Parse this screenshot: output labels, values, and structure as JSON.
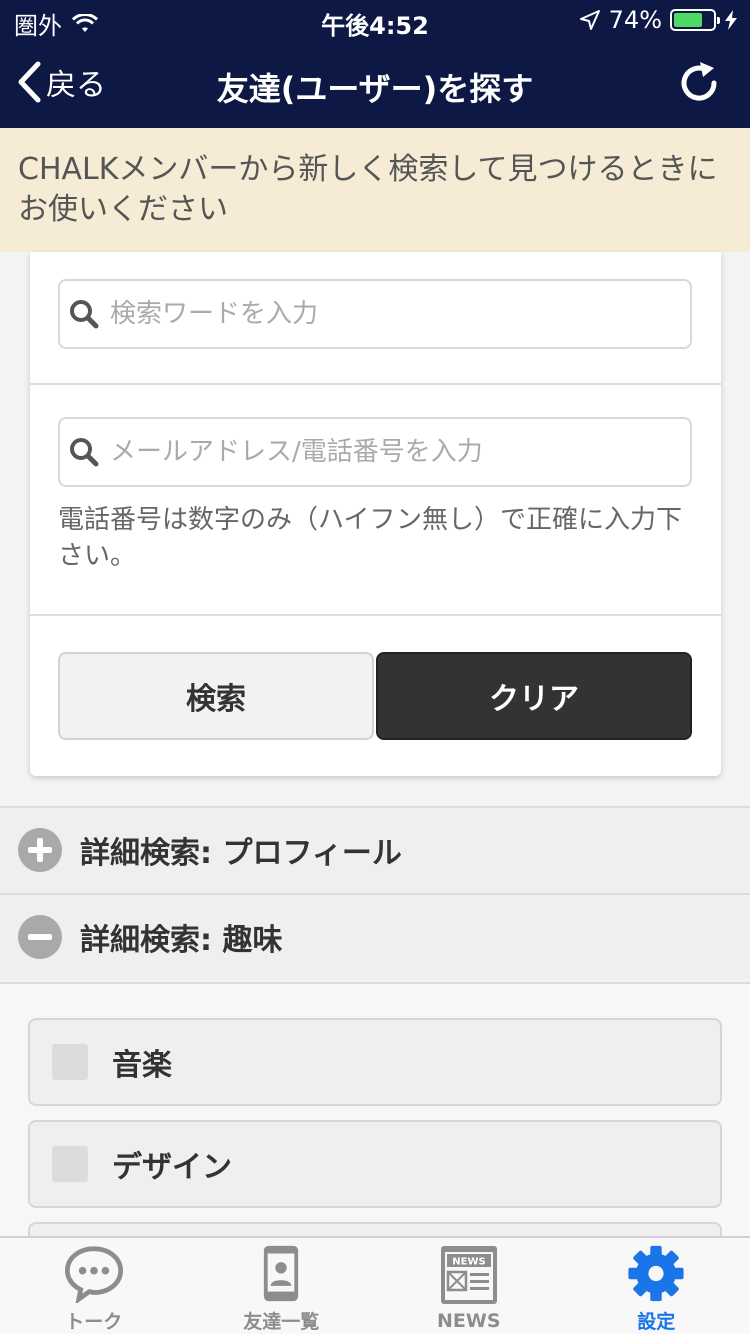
{
  "status_bar": {
    "carrier": "圏外",
    "time": "午後4:52",
    "battery": "74%"
  },
  "nav": {
    "back_label": "戻る",
    "title": "友達(ユーザー)を探す"
  },
  "notice": "CHALKメンバーから新しく検索して見つけるときにお使いください",
  "search": {
    "keyword_placeholder": "検索ワードを入力",
    "contact_placeholder": "メールアドレス/電話番号を入力",
    "hint": "電話番号は数字のみ（ハイフン無し）で正確に入力下さい。",
    "search_button": "検索",
    "clear_button": "クリア"
  },
  "accordions": {
    "profile": {
      "label": "詳細検索: プロフィール",
      "state": "collapsed"
    },
    "hobby": {
      "label": "詳細検索: 趣味",
      "state": "expanded"
    }
  },
  "hobbies": [
    {
      "label": "音楽",
      "checked": false
    },
    {
      "label": "デザイン",
      "checked": false
    }
  ],
  "tabs": [
    {
      "label": "トーク",
      "icon": "chat-bubble-icon"
    },
    {
      "label": "友達一覧",
      "icon": "contacts-phone-icon"
    },
    {
      "label": "NEWS",
      "icon": "news-icon"
    },
    {
      "label": "設定",
      "icon": "gear-icon",
      "active": true
    }
  ],
  "colors": {
    "nav_bg": "#0d1845",
    "notice_bg": "#f6ecd6",
    "active_tab": "#1a75e8",
    "clear_button_bg": "#333333"
  }
}
